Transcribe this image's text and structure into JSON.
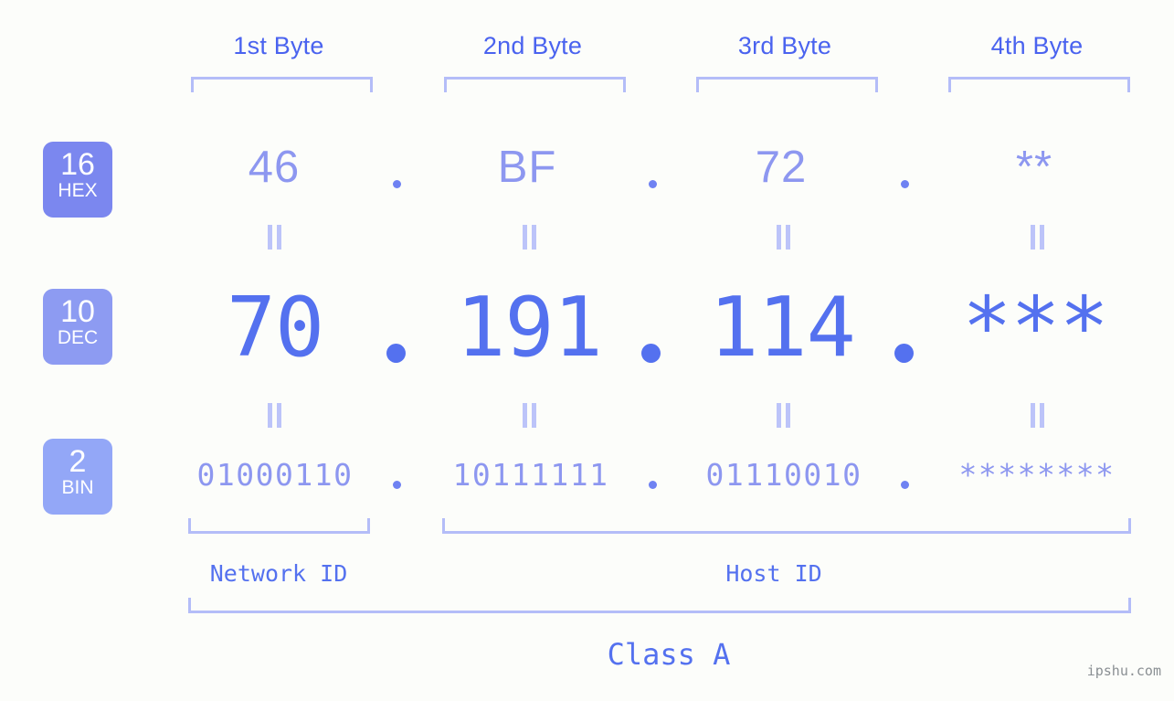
{
  "page": {
    "background_color": "#fcfdfa",
    "accent_color": "#5471ef",
    "muted_accent_color": "#8d97f0",
    "bracket_color": "#b4bdf8",
    "watermark": "ipshu.com"
  },
  "byte_headers": [
    {
      "label": "1st Byte"
    },
    {
      "label": "2nd Byte"
    },
    {
      "label": "3rd Byte"
    },
    {
      "label": "4th Byte"
    }
  ],
  "bases": [
    {
      "number": "16",
      "abbr": "HEX",
      "color": "#7b87ef"
    },
    {
      "number": "10",
      "abbr": "DEC",
      "color": "#8d9bf2"
    },
    {
      "number": "2",
      "abbr": "BIN",
      "color": "#93a7f7"
    }
  ],
  "rows": {
    "hex": {
      "values": [
        "46",
        "BF",
        "72",
        "**"
      ],
      "separator": "."
    },
    "dec": {
      "values": [
        "70",
        "191",
        "114",
        "***"
      ],
      "separator": "."
    },
    "bin": {
      "values": [
        "01000110",
        "10111111",
        "01110010",
        "********"
      ],
      "separator": "."
    }
  },
  "equality_symbol": "=",
  "regions": [
    {
      "label": "Network ID"
    },
    {
      "label": "Host ID"
    }
  ],
  "class": {
    "label": "Class A"
  }
}
